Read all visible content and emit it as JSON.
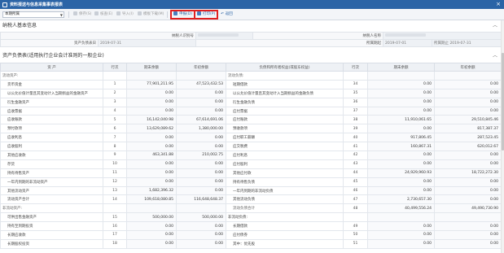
{
  "window": {
    "title": "资料报送与信息采集事表报表"
  },
  "toolbar": {
    "period": "本期所属",
    "buttons": {
      "save": "保存(S)",
      "verify": "核查(E)",
      "import": "导入(I)",
      "template": "模板下载(M)",
      "declare": "申报(D)",
      "print": "打印(P)",
      "back": "返回"
    }
  },
  "taxpayer": {
    "section_title": "纳税人基本信息",
    "id_label": "纳税人识别号",
    "name_label": "纳税人名称",
    "period_start_label": "资产负债表日",
    "period_start_value": "2019-07-31",
    "period_from_label": "所属期起",
    "period_from_value": "2019-07-01",
    "period_to_label": "所属期止",
    "period_to_value": "2019-07-31"
  },
  "balance_sheet": {
    "section_title": "资产负债表(适用执行企业会计准则的一般企业)",
    "headers": {
      "asset": "资 产",
      "line": "行次",
      "end_balance": "期末余额",
      "begin_balance": "年初余额",
      "liability": "负债和所有者权益(或股东权益)"
    },
    "rows": [
      {
        "a": "流动资产:",
        "al": "",
        "ae": "",
        "ab": "",
        "l": "流动负债:",
        "ll": "",
        "le": "",
        "lb": "",
        "sec": true
      },
      {
        "a": "货币资金",
        "al": "1",
        "ae": "77,901,211.95",
        "ab": "47,523,432.53",
        "l": "短期借款",
        "ll": "34",
        "le": "0.00",
        "lb": "0.00"
      },
      {
        "a": "以公允价值计量且其变动计入当期损益的金融资产",
        "al": "2",
        "ae": "0.00",
        "ab": "0.00",
        "l": "以公允价值计量且其变动计入当期损益的金融负债",
        "ll": "35",
        "le": "0.00",
        "lb": "0.00"
      },
      {
        "a": "衍生金融资产",
        "al": "3",
        "ae": "0.00",
        "ab": "0.00",
        "l": "衍生金融负债",
        "ll": "36",
        "le": "0.00",
        "lb": "0.00"
      },
      {
        "a": "应收票据",
        "al": "4",
        "ae": "0.00",
        "ab": "0.00",
        "l": "应付票据",
        "ll": "37",
        "le": "0.00",
        "lb": "0.00"
      },
      {
        "a": "应收账款",
        "al": "5",
        "ae": "16,142,040.98",
        "ab": "67,614,691.06",
        "l": "应付账款",
        "ll": "38",
        "le": "11,910,061.65",
        "lb": "29,510,845.46"
      },
      {
        "a": "预付款项",
        "al": "6",
        "ae": "13,629,089.62",
        "ab": "1,380,000.00",
        "l": "预收款项",
        "ll": "39",
        "le": "0.00",
        "lb": "817,387.37"
      },
      {
        "a": "应收利息",
        "al": "7",
        "ae": "0.00",
        "ab": "0.00",
        "l": "应付职工薪酬",
        "ll": "40",
        "le": "917,806.45",
        "lb": "287,523.45"
      },
      {
        "a": "应收股利",
        "al": "8",
        "ae": "0.00",
        "ab": "0.00",
        "l": "应交税费",
        "ll": "41",
        "le": "160,867.31",
        "lb": "620,012.67"
      },
      {
        "a": "其他应收款",
        "al": "9",
        "ae": "463,341.88",
        "ab": "210,002.75",
        "l": "应付利息",
        "ll": "42",
        "le": "0.00",
        "lb": "0.00"
      },
      {
        "a": "存货",
        "al": "10",
        "ae": "0.00",
        "ab": "0.00",
        "l": "应付股利",
        "ll": "43",
        "le": "0.00",
        "lb": "0.00"
      },
      {
        "a": "持有待售资产",
        "al": "11",
        "ae": "0.00",
        "ab": "0.00",
        "l": "其他应付款",
        "ll": "44",
        "le": "24,929,960.93",
        "lb": "18,722,272.30"
      },
      {
        "a": "一年内到期的非流动资产",
        "al": "12",
        "ae": "0.00",
        "ab": "0.00",
        "l": "持有待售负债",
        "ll": "45",
        "le": "0.00",
        "lb": "0.00"
      },
      {
        "a": "其他流动资产",
        "al": "13",
        "ae": "1,682,396.32",
        "ab": "0.00",
        "l": "一年内到期的非流动负债",
        "ll": "46",
        "le": "0.00",
        "lb": "0.00"
      },
      {
        "a": "流动资产合计",
        "al": "14",
        "ae": "109,618,080.85",
        "ab": "116,648,648.37",
        "l": "其他流动负债",
        "ll": "47",
        "le": "2,730,657.30",
        "lb": "0.00"
      },
      {
        "a": "非流动资产:",
        "al": "",
        "ae": "",
        "ab": "",
        "l": "流动负债合计",
        "ll": "48",
        "le": "40,499,556.24",
        "lb": "49,490,730.90",
        "sec": true
      },
      {
        "a": "可供出售金融资产",
        "al": "15",
        "ae": "500,000.00",
        "ab": "500,000.00",
        "l": "非流动负债:",
        "ll": "",
        "le": "",
        "lb": ""
      },
      {
        "a": "持有至到期投资",
        "al": "16",
        "ae": "0.00",
        "ab": "0.00",
        "l": "长期借款",
        "ll": "49",
        "le": "0.00",
        "lb": "0.00"
      },
      {
        "a": "长期应收款",
        "al": "17",
        "ae": "0.00",
        "ab": "0.00",
        "l": "应付债券",
        "ll": "50",
        "le": "0.00",
        "lb": "0.00"
      },
      {
        "a": "长期股权投资",
        "al": "18",
        "ae": "0.00",
        "ab": "0.00",
        "l": "其中：优先股",
        "ll": "51",
        "le": "0.00",
        "lb": "0.00"
      }
    ]
  }
}
